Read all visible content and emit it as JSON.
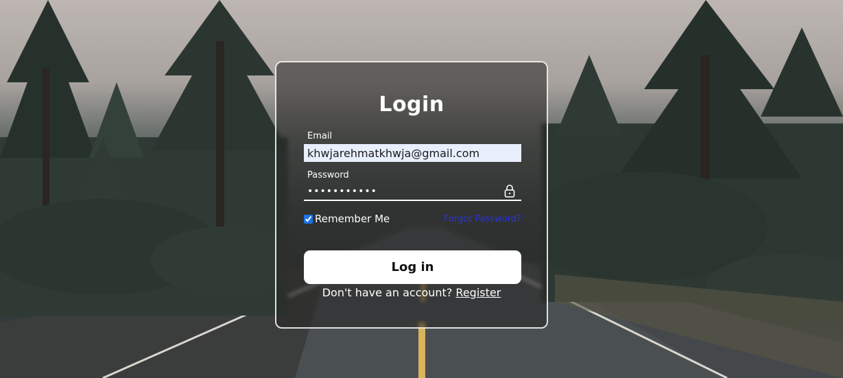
{
  "login": {
    "title": "Login",
    "email_label": "Email",
    "email_value": "khwjarehmatkhwja@gmail.com",
    "password_label": "Password",
    "password_value": "•••••••••••",
    "remember_label": "Remember Me",
    "remember_checked": true,
    "forgot_label": "Forgot Password?",
    "button_label": "Log in",
    "register_prompt": "Don't have an account?",
    "register_link": "Register"
  },
  "icons": {
    "password_field": "lock-icon"
  },
  "colors": {
    "card_border": "#ffffff",
    "button_bg": "#ffffff",
    "forgot_link": "#2a34d8",
    "autofill_bg": "#e8f0fe"
  }
}
